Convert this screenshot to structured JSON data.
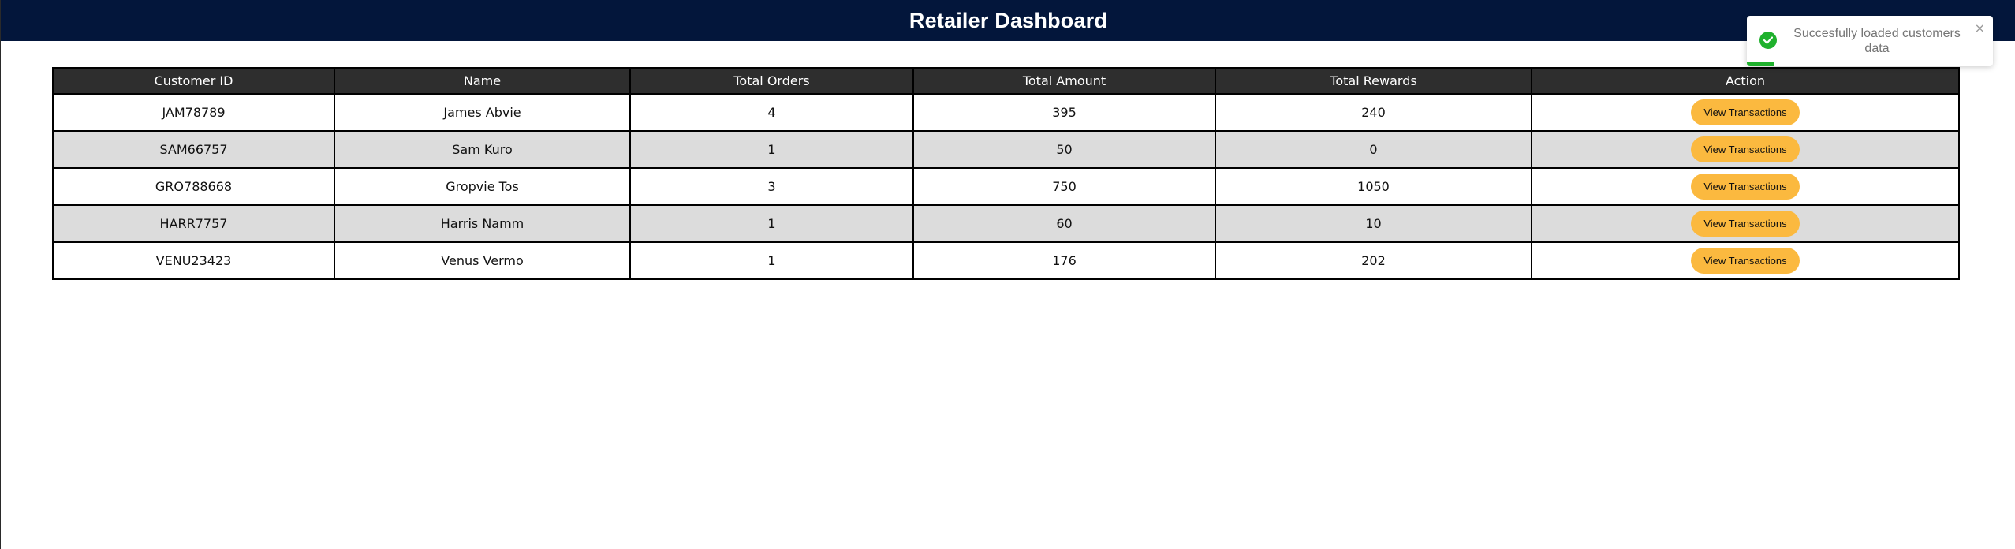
{
  "header": {
    "title": "Retailer Dashboard"
  },
  "table": {
    "columns": [
      "Customer ID",
      "Name",
      "Total Orders",
      "Total Amount",
      "Total Rewards",
      "Action"
    ],
    "rows": [
      {
        "customer_id": "JAM78789",
        "name": "James Abvie",
        "total_orders": "4",
        "total_amount": "395",
        "total_rewards": "240",
        "action_label": "View Transactions"
      },
      {
        "customer_id": "SAM66757",
        "name": "Sam Kuro",
        "total_orders": "1",
        "total_amount": "50",
        "total_rewards": "0",
        "action_label": "View Transactions"
      },
      {
        "customer_id": "GRO788668",
        "name": "Gropvie Tos",
        "total_orders": "3",
        "total_amount": "750",
        "total_rewards": "1050",
        "action_label": "View Transactions"
      },
      {
        "customer_id": "HARR7757",
        "name": "Harris Namm",
        "total_orders": "1",
        "total_amount": "60",
        "total_rewards": "10",
        "action_label": "View Transactions"
      },
      {
        "customer_id": "VENU23423",
        "name": "Venus Vermo",
        "total_orders": "1",
        "total_amount": "176",
        "total_rewards": "202",
        "action_label": "View Transactions"
      }
    ]
  },
  "toast": {
    "message": "Succesfully loaded customers data",
    "close_symbol": "×",
    "icon": "check-circle-icon",
    "progress": 0.11,
    "color": "#1fb12d"
  },
  "colors": {
    "header_bg": "#03163b",
    "table_header_bg": "#2e2e2e",
    "row_alt_bg": "#dcdcdc",
    "button_bg": "#fbb93f"
  }
}
